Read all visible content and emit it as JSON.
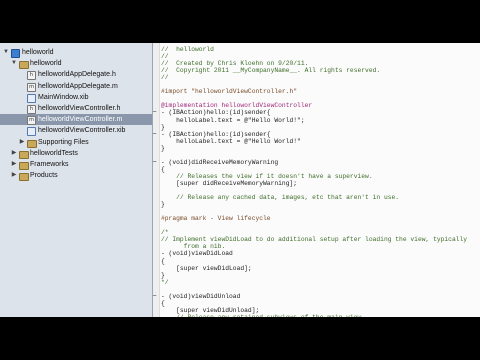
{
  "sidebar": {
    "items": [
      {
        "label": "helloworld",
        "icon": "project-icon",
        "disclosure": "▼",
        "indent": 0,
        "selected": false
      },
      {
        "label": "helloworld",
        "icon": "folder-icon",
        "disclosure": "▼",
        "indent": 1,
        "selected": false
      },
      {
        "label": "helloworldAppDelegate.h",
        "icon": "header-file-icon",
        "disclosure": "",
        "indent": 2,
        "selected": false
      },
      {
        "label": "helloworldAppDelegate.m",
        "icon": "implementation-file-icon",
        "disclosure": "",
        "indent": 2,
        "selected": false
      },
      {
        "label": "MainWindow.xib",
        "icon": "xib-file-icon",
        "disclosure": "",
        "indent": 2,
        "selected": false
      },
      {
        "label": "helloworldViewController.h",
        "icon": "header-file-icon",
        "disclosure": "",
        "indent": 2,
        "selected": false
      },
      {
        "label": "helloworldViewController.m",
        "icon": "implementation-file-icon",
        "disclosure": "",
        "indent": 2,
        "selected": true
      },
      {
        "label": "helloworldViewController.xib",
        "icon": "xib-file-icon",
        "disclosure": "",
        "indent": 2,
        "selected": false
      },
      {
        "label": "Supporting Files",
        "icon": "folder-icon",
        "disclosure": "▶",
        "indent": 2,
        "selected": false
      },
      {
        "label": "helloworldTests",
        "icon": "folder-icon",
        "disclosure": "▶",
        "indent": 1,
        "selected": false
      },
      {
        "label": "Frameworks",
        "icon": "folder-icon",
        "disclosure": "▶",
        "indent": 1,
        "selected": false
      },
      {
        "label": "Products",
        "icon": "folder-icon",
        "disclosure": "▶",
        "indent": 1,
        "selected": false
      }
    ]
  },
  "editor": {
    "lines": [
      {
        "text": "//  helloworld",
        "style": "comment",
        "marker": ""
      },
      {
        "text": "//",
        "style": "comment",
        "marker": ""
      },
      {
        "text": "//  Created by Chris Kloehn on 9/20/11.",
        "style": "comment",
        "marker": ""
      },
      {
        "text": "//  Copyright 2011 __MyCompanyName__. All rights reserved.",
        "style": "comment",
        "marker": ""
      },
      {
        "text": "//",
        "style": "comment",
        "marker": ""
      },
      {
        "text": "",
        "style": "plain",
        "marker": ""
      },
      {
        "text": "#import \"helloworldViewController.h\"",
        "style": "pre",
        "marker": ""
      },
      {
        "text": "",
        "style": "plain",
        "marker": ""
      },
      {
        "text": "@implementation helloworldViewController",
        "style": "kw",
        "marker": ""
      },
      {
        "text": "- (IBAction)hello:(id)sender{",
        "style": "plain",
        "marker": "–"
      },
      {
        "text": "    helloLabel.text = @\"Hello World!\";",
        "style": "plain",
        "marker": ""
      },
      {
        "text": "}",
        "style": "plain",
        "marker": ""
      },
      {
        "text": "- (IBAction)hello:(id)sender{",
        "style": "plain",
        "marker": "–"
      },
      {
        "text": "    helloLabel.text = @\"Hello World!\"",
        "style": "plain",
        "marker": ""
      },
      {
        "text": "}",
        "style": "plain",
        "marker": ""
      },
      {
        "text": "",
        "style": "plain",
        "marker": ""
      },
      {
        "text": "- (void)didReceiveMemoryWarning",
        "style": "plain",
        "marker": "–"
      },
      {
        "text": "{",
        "style": "plain",
        "marker": ""
      },
      {
        "text": "    // Releases the view if it doesn't have a superview.",
        "style": "comment",
        "marker": ""
      },
      {
        "text": "    [super didReceiveMemoryWarning];",
        "style": "plain",
        "marker": ""
      },
      {
        "text": "",
        "style": "plain",
        "marker": ""
      },
      {
        "text": "    // Release any cached data, images, etc that aren't in use.",
        "style": "comment",
        "marker": ""
      },
      {
        "text": "}",
        "style": "plain",
        "marker": ""
      },
      {
        "text": "",
        "style": "plain",
        "marker": ""
      },
      {
        "text": "#pragma mark - View lifecycle",
        "style": "pre",
        "marker": ""
      },
      {
        "text": "",
        "style": "plain",
        "marker": ""
      },
      {
        "text": "/*",
        "style": "comment",
        "marker": ""
      },
      {
        "text": "// Implement viewDidLoad to do additional setup after loading the view, typically",
        "style": "comment",
        "marker": ""
      },
      {
        "text": "      from a nib.",
        "style": "comment",
        "marker": ""
      },
      {
        "text": "- (void)viewDidLoad",
        "style": "plain",
        "marker": ""
      },
      {
        "text": "{",
        "style": "plain",
        "marker": ""
      },
      {
        "text": "    [super viewDidLoad];",
        "style": "plain",
        "marker": ""
      },
      {
        "text": "}",
        "style": "plain",
        "marker": ""
      },
      {
        "text": "*/",
        "style": "comment",
        "marker": ""
      },
      {
        "text": "",
        "style": "plain",
        "marker": ""
      },
      {
        "text": "- (void)viewDidUnload",
        "style": "plain",
        "marker": "–"
      },
      {
        "text": "{",
        "style": "plain",
        "marker": ""
      },
      {
        "text": "    [super viewDidUnload];",
        "style": "plain",
        "marker": ""
      },
      {
        "text": "    // Release any retained subviews of the main view.",
        "style": "comment",
        "marker": ""
      }
    ]
  }
}
